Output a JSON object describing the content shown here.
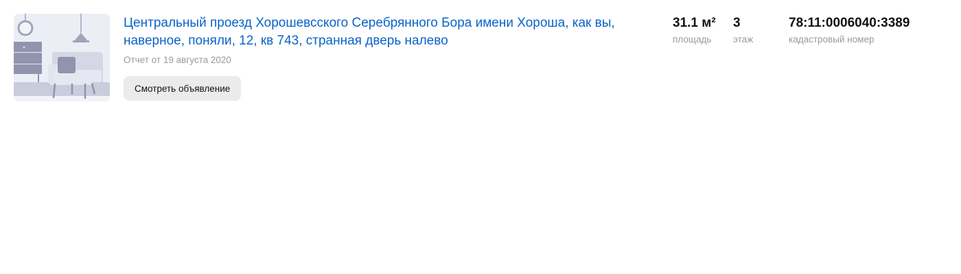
{
  "listing": {
    "address": "Центральный проезд Хорошевсского Серебрянного Бора имени Хороша, как вы, наверное, поняли, 12, кв 743, странная дверь налево",
    "report_date": "Отчет от 19 августа 2020",
    "view_button_label": "Смотреть объявление",
    "thumbnail_icon": "room-illustration-icon"
  },
  "stats": {
    "area": {
      "value": "31.1 м²",
      "label": "площадь"
    },
    "floor": {
      "value": "3",
      "label": "этаж"
    },
    "cadastral": {
      "value": "78:11:0006040:3389",
      "label": "кадастровый номер"
    }
  },
  "colors": {
    "link": "#0a63c9",
    "muted": "#9a9a9a",
    "button_bg": "#ebebeb",
    "thumb_bg": "#eceef6"
  }
}
